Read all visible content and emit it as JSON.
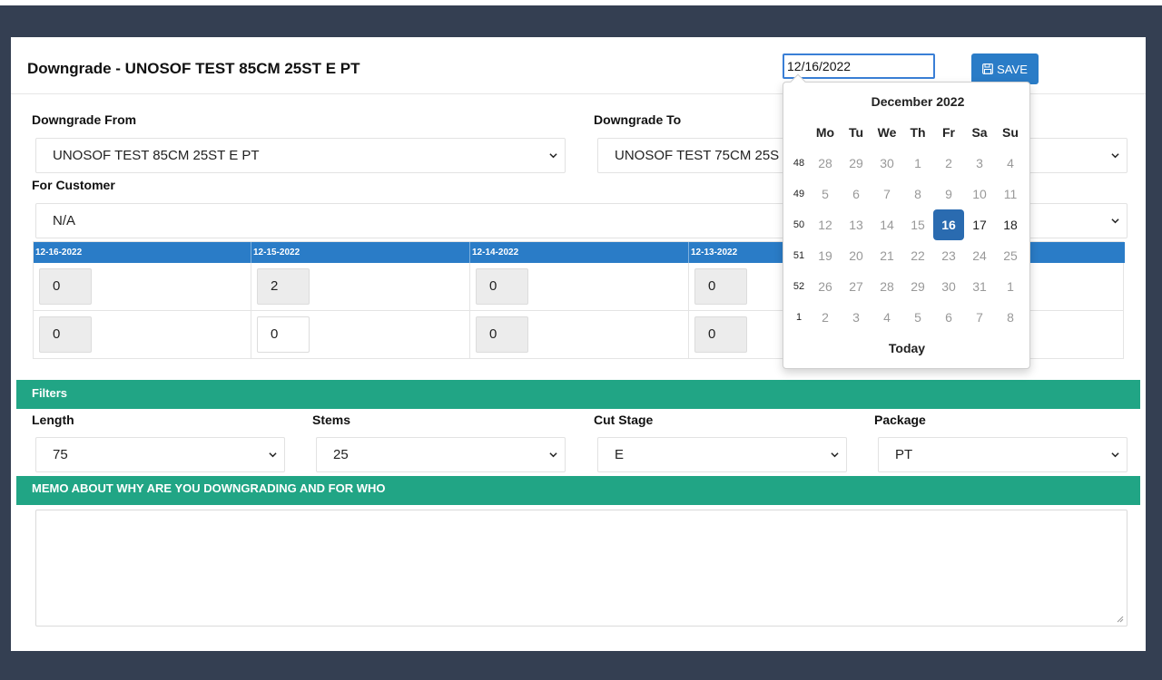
{
  "header": {
    "title": "Downgrade - UNOSOF TEST 85CM 25ST E PT",
    "date_value": "12/16/2022",
    "save_label": "SAVE"
  },
  "form": {
    "from_label": "Downgrade From",
    "from_value": "UNOSOF TEST 85CM 25ST E PT",
    "to_label": "Downgrade To",
    "to_value": "UNOSOF TEST 75CM 25S",
    "customer_label": "For Customer",
    "customer_value": "N/A"
  },
  "grid": {
    "columns": [
      "12-16-2022",
      "12-15-2022",
      "12-14-2022",
      "12-13-2022"
    ],
    "rows": [
      [
        "0",
        "2",
        "0",
        "0"
      ],
      [
        "0",
        "0",
        "0",
        "0"
      ]
    ]
  },
  "filters": {
    "bar_label": "Filters",
    "length_label": "Length",
    "length_value": "75",
    "stems_label": "Stems",
    "stems_value": "25",
    "cut_stage_label": "Cut Stage",
    "cut_stage_value": "E",
    "package_label": "Package",
    "package_value": "PT"
  },
  "memo": {
    "bar_label": "MEMO ABOUT WHY ARE YOU DOWNGRADING AND FOR WHO",
    "value": ""
  },
  "datepicker": {
    "month_label": "December 2022",
    "weekdays": [
      "Mo",
      "Tu",
      "We",
      "Th",
      "Fr",
      "Sa",
      "Su"
    ],
    "weeks": [
      {
        "num": "48",
        "days": [
          "28",
          "29",
          "30",
          "1",
          "2",
          "3",
          "4"
        ]
      },
      {
        "num": "49",
        "days": [
          "5",
          "6",
          "7",
          "8",
          "9",
          "10",
          "11"
        ]
      },
      {
        "num": "50",
        "days": [
          "12",
          "13",
          "14",
          "15",
          "16",
          "17",
          "18"
        ]
      },
      {
        "num": "51",
        "days": [
          "19",
          "20",
          "21",
          "22",
          "23",
          "24",
          "25"
        ]
      },
      {
        "num": "52",
        "days": [
          "26",
          "27",
          "28",
          "29",
          "30",
          "31",
          "1"
        ]
      },
      {
        "num": "1",
        "days": [
          "2",
          "3",
          "4",
          "5",
          "6",
          "7",
          "8"
        ]
      }
    ],
    "selected_day": "16",
    "today_label": "Today"
  },
  "colors": {
    "accent_blue": "#2a7cc7",
    "filter_green": "#21a585",
    "background": "#343f52",
    "selected_day": "#2a6bb0"
  }
}
